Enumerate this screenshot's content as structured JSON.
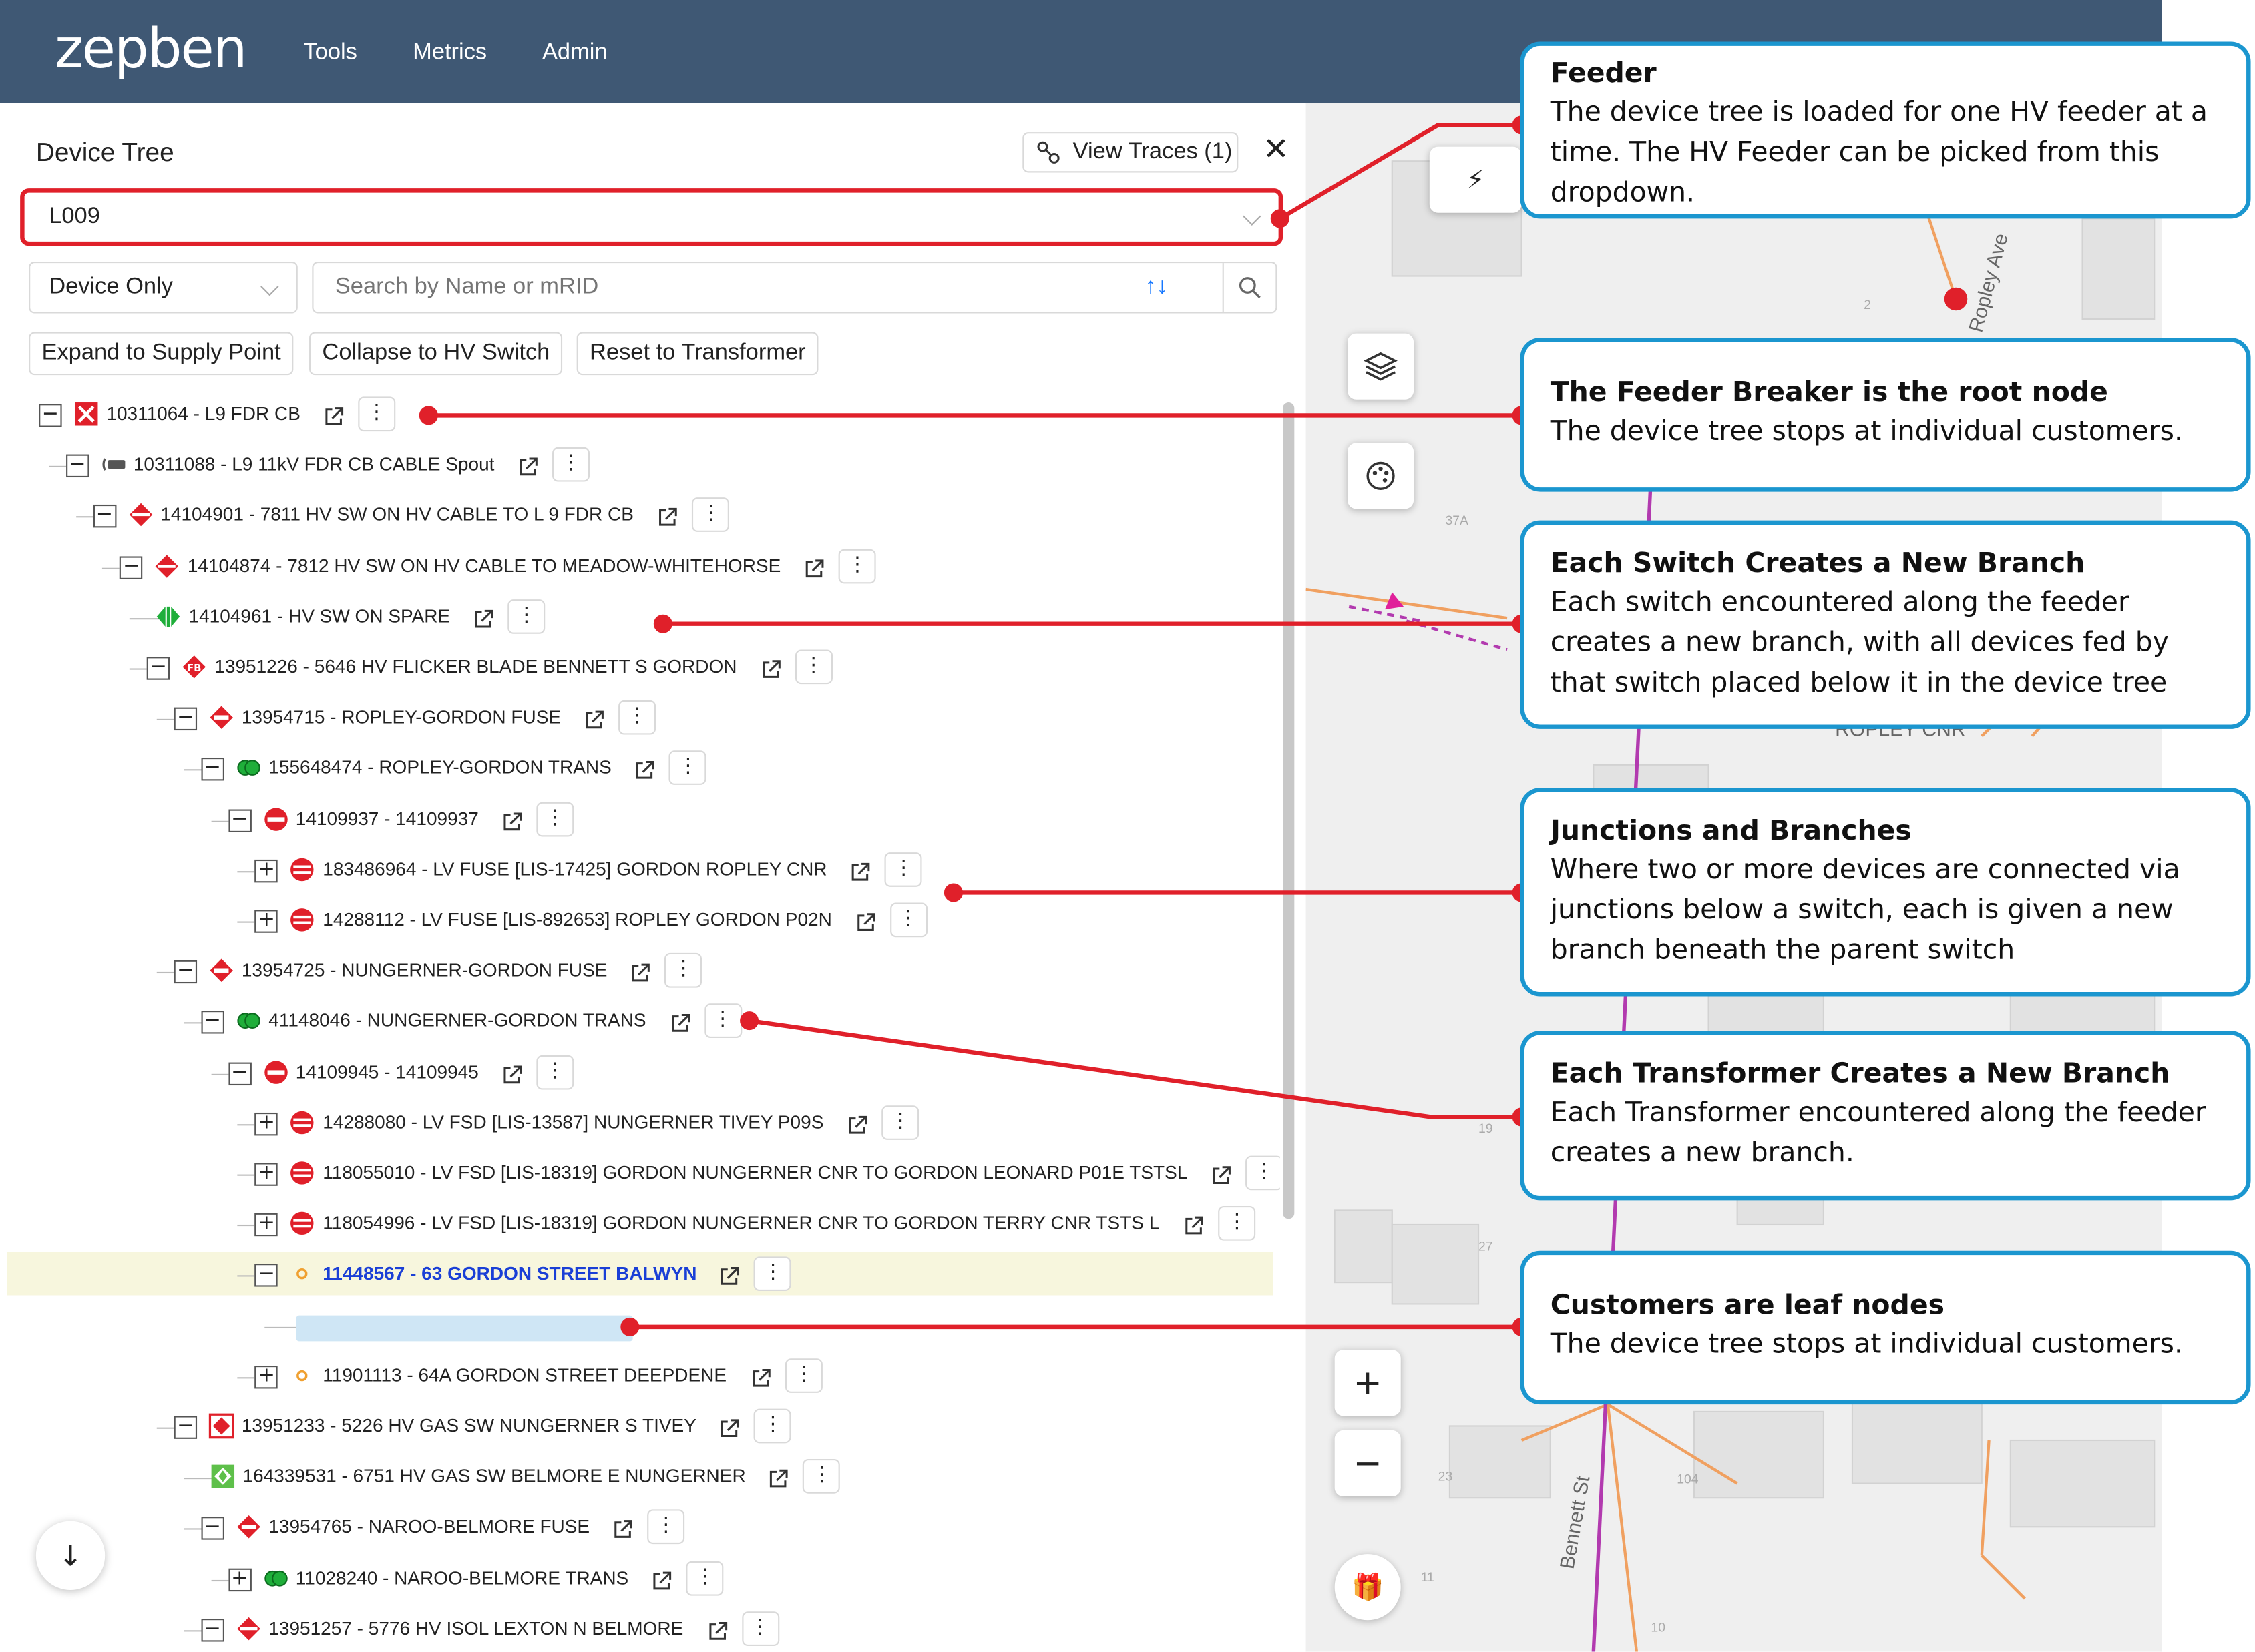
{
  "app": {
    "logo": "zepben",
    "nav": [
      "Tools",
      "Metrics",
      "Admin"
    ]
  },
  "panel": {
    "title": "Device Tree",
    "view_traces": "View Traces (1)",
    "close": "✕",
    "feeder_value": "L009",
    "filter_value": "Device Only",
    "search_placeholder": "Search by Name or mRID",
    "search_arrows": "↑↓",
    "buttons": [
      "Expand to Supply Point",
      "Collapse to HV Switch",
      "Reset to Transformer"
    ]
  },
  "tree": [
    {
      "depth": 0,
      "toggle": "−",
      "icon": "breaker-icon",
      "label": "10311064 - L9 FDR CB"
    },
    {
      "depth": 1,
      "toggle": "−",
      "icon": "cable-spout-icon",
      "label": "10311088 - L9 11kV FDR CB CABLE Spout"
    },
    {
      "depth": 2,
      "toggle": "−",
      "icon": "hv-switch-icon",
      "label": "14104901 - 7811 HV SW ON HV CABLE TO L 9 FDR CB"
    },
    {
      "depth": 3,
      "toggle": "−",
      "icon": "hv-switch-icon",
      "label": "14104874 - 7812 HV SW ON HV CABLE TO MEADOW-WHITEHORSE"
    },
    {
      "depth": 4,
      "toggle": "",
      "icon": "spare-switch-icon",
      "label": "14104961 - HV SW ON SPARE"
    },
    {
      "depth": 4,
      "toggle": "−",
      "icon": "fb-switch-icon",
      "label": "13951226 - 5646 HV FLICKER BLADE BENNETT S GORDON"
    },
    {
      "depth": 5,
      "toggle": "−",
      "icon": "fuse-icon",
      "label": "13954715 - ROPLEY-GORDON FUSE"
    },
    {
      "depth": 6,
      "toggle": "−",
      "icon": "transformer-icon",
      "label": "155648474 - ROPLEY-GORDON TRANS"
    },
    {
      "depth": 7,
      "toggle": "−",
      "icon": "lv-junction-icon",
      "label": "14109937 - 14109937"
    },
    {
      "depth": 8,
      "toggle": "+",
      "icon": "lv-fuse-icon",
      "label": "183486964 - LV FUSE [LIS-17425] GORDON ROPLEY CNR"
    },
    {
      "depth": 8,
      "toggle": "+",
      "icon": "lv-fuse-icon",
      "label": "14288112 - LV FUSE [LIS-892653] ROPLEY GORDON P02N"
    },
    {
      "depth": 5,
      "toggle": "−",
      "icon": "fuse-icon",
      "label": "13954725 - NUNGERNER-GORDON FUSE"
    },
    {
      "depth": 6,
      "toggle": "−",
      "icon": "transformer-icon",
      "label": "41148046 - NUNGERNER-GORDON TRANS"
    },
    {
      "depth": 7,
      "toggle": "−",
      "icon": "lv-junction-icon",
      "label": "14109945 - 14109945"
    },
    {
      "depth": 8,
      "toggle": "+",
      "icon": "lv-fuse-icon",
      "label": "14288080 - LV FSD [LIS-13587] NUNGERNER TIVEY P09S"
    },
    {
      "depth": 8,
      "toggle": "+",
      "icon": "lv-fuse-icon",
      "label": "118055010 - LV FSD [LIS-18319] GORDON NUNGERNER CNR TO GORDON LEONARD P01E TSTSL"
    },
    {
      "depth": 8,
      "toggle": "+",
      "icon": "lv-fuse-icon",
      "label": "118054996 - LV FSD [LIS-18319] GORDON NUNGERNER CNR TO GORDON TERRY CNR TSTS L"
    },
    {
      "depth": 8,
      "toggle": "−",
      "icon": "customer-icon",
      "label": "11448567 - 63 GORDON STREET BALWYN",
      "selected": true
    },
    {
      "depth": 9,
      "toggle": "",
      "icon": "",
      "label": "",
      "loading": true
    },
    {
      "depth": 8,
      "toggle": "+",
      "icon": "customer-icon",
      "label": "11901113 - 64A GORDON STREET DEEPDENE"
    },
    {
      "depth": 5,
      "toggle": "−",
      "icon": "gas-switch-icon",
      "label": "13951233 - 5226 HV GAS SW NUNGERNER S TIVEY"
    },
    {
      "depth": 6,
      "toggle": "",
      "icon": "gas-switch-open-icon",
      "label": "164339531 - 6751 HV GAS SW BELMORE E NUNGERNER"
    },
    {
      "depth": 6,
      "toggle": "−",
      "icon": "fuse-icon",
      "label": "13954765 - NAROO-BELMORE FUSE"
    },
    {
      "depth": 7,
      "toggle": "+",
      "icon": "transformer-icon",
      "label": "11028240 - NAROO-BELMORE TRANS"
    },
    {
      "depth": 6,
      "toggle": "−",
      "icon": "hv-switch-icon",
      "label": "13951257 - 5776 HV ISOL LEXTON N BELMORE"
    }
  ],
  "map": {
    "labels": [
      "Ropley Ave",
      "ROPLEY CNR",
      "Bennett St"
    ],
    "numbers": [
      "2",
      "37A",
      "19",
      "27",
      "23",
      "11",
      "10",
      "104"
    ]
  },
  "callouts": [
    {
      "title": "Feeder",
      "body": "The device tree is loaded for one HV feeder at a time. The HV Feeder can be picked from this dropdown."
    },
    {
      "title": "The Feeder Breaker is the root node",
      "body": "The device tree stops at individual customers."
    },
    {
      "title": "Each Switch Creates a New Branch",
      "body": "Each switch encountered along the feeder creates a new branch, with all devices fed by that switch placed below it in the device tree"
    },
    {
      "title": "Junctions and Branches",
      "body": "Where two or more devices are connected via junctions below a switch, each is given a new branch beneath the parent switch"
    },
    {
      "title": "Each Transformer Creates a New Branch",
      "body": "Each Transformer encountered along the feeder creates a new branch."
    },
    {
      "title": "Customers are leaf nodes",
      "body": "The device tree stops at individual customers."
    }
  ],
  "colors": {
    "header": "#3f5874",
    "accent": "#1677ff",
    "annotation": "#e0202a",
    "callout_border": "#1b96cf",
    "selected_row": "#f7f6dd"
  }
}
